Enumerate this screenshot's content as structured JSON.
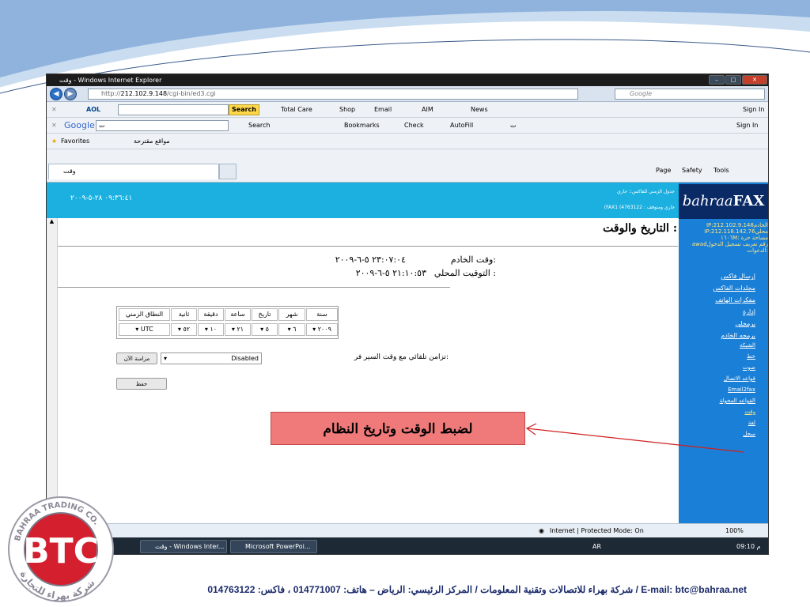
{
  "window": {
    "title": "وقت - Windows Internet Explorer"
  },
  "address": {
    "url_prefix": "http://",
    "url_host": "212.102.9.148",
    "url_path": "/cgi-bin/ed3.cgi",
    "search_placeholder": "Google"
  },
  "aol_toolbar": {
    "brand": "AOL",
    "search_label": "Search",
    "total_care": "Total Care",
    "shop": "Shop",
    "email": "Email",
    "aim": "AIM",
    "news": "News",
    "sign_in": "Sign In"
  },
  "google_toolbar": {
    "brand": "Google",
    "input_value": "ت",
    "search": "Search",
    "bookmarks": "Bookmarks",
    "check": "Check",
    "autofill": "AutoFill",
    "sign_in": "Sign In",
    "extra": "ت"
  },
  "favorites": {
    "label": "Favorites",
    "suggested": "مواقع مقترحة"
  },
  "tab": {
    "title": "وقت"
  },
  "command_bar": {
    "page": "Page",
    "safety": "Safety",
    "tools": "Tools"
  },
  "banner": {
    "clock": "٠٩:٣٦:٤١ ٢٨-٥-٢٠٠٩",
    "status1": "جدول الزمني للفاكس:: جاري",
    "status2": "(FAX1 (4763122 : جاري ومتوقف"
  },
  "sidebar": {
    "logo_prefix": "bahraa",
    "logo_suffix": "FAX",
    "info_lines": [
      "IP:212.102.9.148الخادم",
      "IP:212.118.142.76محلي",
      "١٦٠٦M: مساحة حرة",
      "awadرقم تعريف تسجيل الدخول",
      "الدعوات:"
    ],
    "links": [
      "إرسال فاكس",
      "مجلدات الفاكس",
      "مفكرات الهاتف",
      "إدارة",
      "برمجلي",
      "برمجه الخادم",
      "الشبكة",
      "خط",
      "صوت",
      "قواعد الاتصال",
      "Email2fax",
      "القواعد المخولة",
      "وقت",
      "لغة",
      "سجل"
    ]
  },
  "main": {
    "title": "التاريخ والوقت :",
    "server_time_label": "وقت الخادم:",
    "server_time_value": "٢٣:٠٧:٠٤ ٥-٦-٢٠٠٩",
    "local_time_label": "التوقيت المحلي :",
    "local_time_value": "٢١:١٠:٥٣ ٥-٦-٢٠٠٩",
    "table_headers": [
      "سنة",
      "شهر",
      "تاريخ",
      "ساعة",
      "دقيقة",
      "ثانية",
      "النطاق الزمني"
    ],
    "table_values": [
      "٢٠٠٩",
      "٦",
      "٥",
      "٢١",
      "١٠",
      "٥٢",
      "UTC"
    ],
    "sync_label": "تزامن تلقائي مع وقت السير فر:",
    "sync_value": "Disabled",
    "sync_now": "مزامنة الآن",
    "save": "حفظ"
  },
  "statusbar": {
    "zone": "Internet | Protected Mode: On",
    "zoom": "100%"
  },
  "taskbar": {
    "task1": "وقت - Windows Inter...",
    "task2": "Microsoft PowerPoi...",
    "lang": "AR",
    "time": "09:10 م"
  },
  "callout": {
    "text": "لضبط الوقت وتاريخ النظام"
  },
  "company_logo": {
    "letters": "BTC",
    "ring_en": "BAHRAA TRADING CO.",
    "ring_ar": "شركة بهراء للتجارة"
  },
  "footer": {
    "text": "شركة بهراء للاتصالات وتقنية المعلومات / المركز الرئيسي: الرياض – هاتف: 014771007 ، فاكس: 014763122 / E-mail: btc@bahraa.net"
  }
}
